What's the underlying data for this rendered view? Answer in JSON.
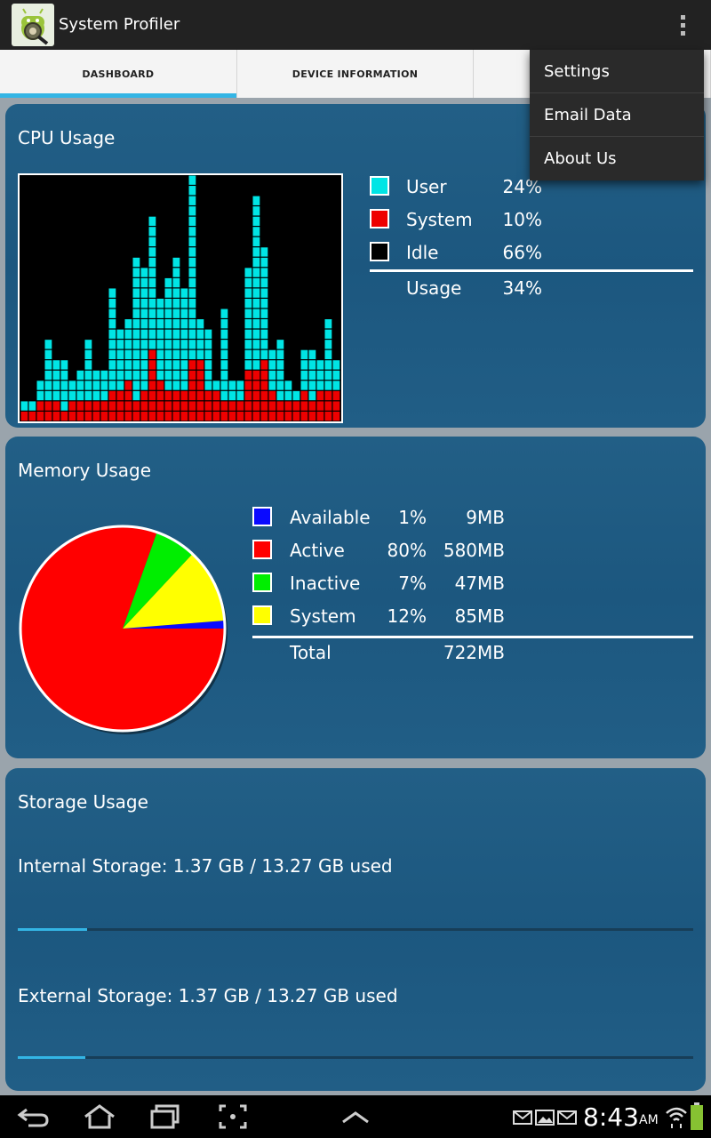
{
  "app": {
    "title": "System Profiler",
    "icon": "android-app-icon"
  },
  "tabs": [
    {
      "label": "DASHBOARD",
      "active": true
    },
    {
      "label": "DEVICE INFORMATION",
      "active": false
    },
    {
      "label": "",
      "active": false
    }
  ],
  "menu": {
    "items": [
      "Settings",
      "Email Data",
      "About Us"
    ]
  },
  "cpu": {
    "title": "CPU Usage",
    "legend": [
      {
        "label": "User",
        "value": "24%",
        "color": "#00e5e5"
      },
      {
        "label": "System",
        "value": "10%",
        "color": "#ee0000"
      },
      {
        "label": "Idle",
        "value": "66%",
        "color": "#000000"
      }
    ],
    "total": {
      "label": "Usage",
      "value": "34%"
    }
  },
  "memory": {
    "title": "Memory Usage",
    "legend": [
      {
        "label": "Available",
        "pct": "1%",
        "size": "9MB",
        "color": "#0a0aff"
      },
      {
        "label": "Active",
        "pct": "80%",
        "size": "580MB",
        "color": "#ff0000"
      },
      {
        "label": "Inactive",
        "pct": "7%",
        "size": "47MB",
        "color": "#00ee00"
      },
      {
        "label": "System",
        "pct": "12%",
        "size": "85MB",
        "color": "#ffff00"
      }
    ],
    "total": {
      "label": "Total",
      "size": "722MB"
    }
  },
  "storage": {
    "title": "Storage Usage",
    "internal": {
      "label": "Internal Storage: 1.37 GB / 13.27 GB used",
      "progress": 0.103,
      "secondary": 0.074
    },
    "external": {
      "label": "External Storage: 1.37 GB / 13.27 GB used",
      "progress": 0.1
    }
  },
  "status": {
    "time": "8:43",
    "ampm": "AM"
  },
  "chart_data": [
    {
      "type": "bar",
      "title": "CPU Usage",
      "note": "stacked cell history, newest at right",
      "series": [
        {
          "name": "System",
          "values": [
            1,
            1,
            2,
            2,
            2,
            1,
            2,
            2,
            2,
            2,
            2,
            3,
            3,
            4,
            2,
            3,
            7,
            4,
            3,
            3,
            3,
            6,
            6,
            3,
            3,
            2,
            2,
            2,
            5,
            5,
            6,
            3,
            2,
            2,
            2,
            3,
            2,
            3,
            3,
            3
          ]
        },
        {
          "name": "User",
          "values": [
            1,
            1,
            2,
            6,
            4,
            5,
            2,
            3,
            6,
            3,
            3,
            10,
            6,
            6,
            14,
            12,
            13,
            8,
            11,
            13,
            10,
            22,
            4,
            6,
            1,
            9,
            2,
            2,
            10,
            17,
            11,
            4,
            6,
            2,
            1,
            4,
            5,
            3,
            7,
            3
          ]
        }
      ],
      "ylim": [
        0,
        24
      ]
    },
    {
      "type": "pie",
      "title": "Memory Usage",
      "categories": [
        "Available",
        "Active",
        "Inactive",
        "System"
      ],
      "values": [
        9,
        580,
        47,
        85
      ]
    }
  ]
}
